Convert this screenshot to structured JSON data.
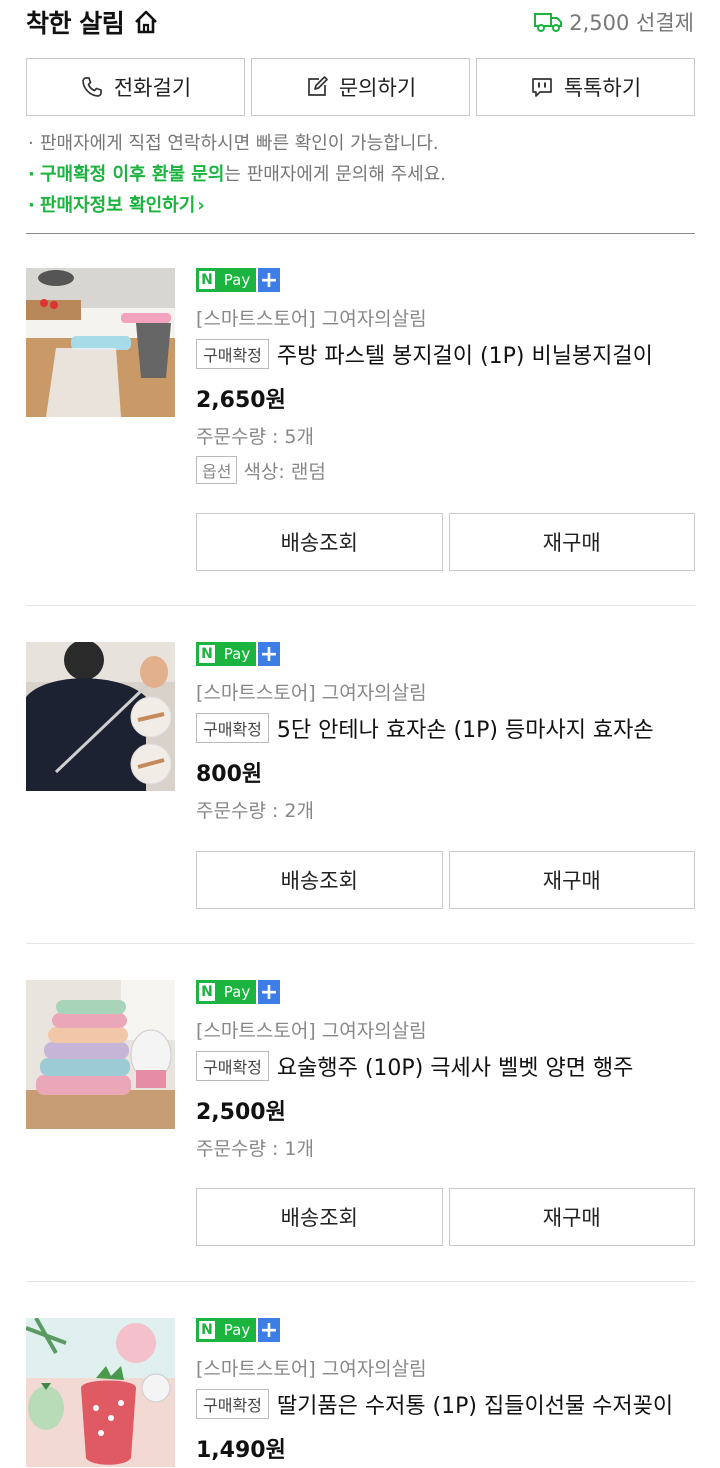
{
  "header": {
    "store_name": "착한 살림",
    "shipping_text": "2,500 선결제",
    "icons": {
      "home": "home-icon",
      "truck": "truck-icon"
    }
  },
  "contact_buttons": [
    {
      "label": "전화걸기",
      "icon": "phone-icon"
    },
    {
      "label": "문의하기",
      "icon": "edit-icon"
    },
    {
      "label": "톡톡하기",
      "icon": "chat-icon"
    }
  ],
  "notes": {
    "line1": "판매자에게 직접 연락하시면 빠른 확인이 가능합니다.",
    "line2_highlight": "구매확정 이후 환불 문의",
    "line2_rest": "는 판매자에게 문의해 주세요.",
    "line3": "판매자정보 확인하기",
    "bullet": "·",
    "line3_chevron": "›"
  },
  "npay": {
    "n": "N",
    "pay": "Pay",
    "plus": "+"
  },
  "items": [
    {
      "seller": "[스마트스토어] 그여자의살림",
      "badge": "구매확정",
      "title": "주방 파스텔 봉지걸이 (1P) 비닐봉지걸이",
      "price": "2,650원",
      "qty": "주문수량 : 5개",
      "option_badge": "옵션",
      "option_value": "색상: 랜덤",
      "btn_track": "배송조회",
      "btn_rebuy": "재구매"
    },
    {
      "seller": "[스마트스토어] 그여자의살림",
      "badge": "구매확정",
      "title": "5단 안테나 효자손 (1P) 등마사지 효자손",
      "price": "800원",
      "qty": "주문수량 : 2개",
      "btn_track": "배송조회",
      "btn_rebuy": "재구매"
    },
    {
      "seller": "[스마트스토어] 그여자의살림",
      "badge": "구매확정",
      "title": "요술행주 (10P) 극세사 벨벳 양면 행주",
      "price": "2,500원",
      "qty": "주문수량 : 1개",
      "btn_track": "배송조회",
      "btn_rebuy": "재구매"
    },
    {
      "seller": "[스마트스토어] 그여자의살림",
      "badge": "구매확정",
      "title": "딸기품은 수저통 (1P) 집들이선물 수저꽂이",
      "price": "1,490원"
    }
  ],
  "colors": {
    "green": "#1bb43e",
    "npay_blue": "#3d7ee6"
  }
}
